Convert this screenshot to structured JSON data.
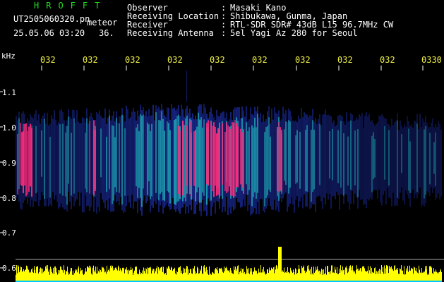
{
  "header": {
    "app_title": "HROFFT",
    "filename": "UT2505060320.pn",
    "file_type": "meteor",
    "datetime": "25.05.06 03:20",
    "value": "36."
  },
  "station_info": [
    {
      "label": "Observer",
      "value": "Masaki Kano"
    },
    {
      "label": "Receiving Location",
      "value": "Shibukawa, Gunma, Japan"
    },
    {
      "label": "Receiver",
      "value": "RTL-SDR SDR# 43dB L15 96.7MHz CW"
    },
    {
      "label": "Receiving Antenna",
      "value": "5el Yagi Az 280 for Seoul"
    }
  ],
  "separator": ":",
  "frequency_axis": {
    "unit": "kHz",
    "ticks": [
      "1.1",
      "1.0",
      "0.9",
      "0.8",
      "0.7",
      "0.6"
    ]
  },
  "time_axis": {
    "ticks": [
      "032",
      "032",
      "032",
      "032",
      "032",
      "032",
      "032",
      "032",
      "032",
      "0330"
    ]
  },
  "colors": {
    "background": "#000000",
    "title_green": "#22dd22",
    "time_tick_yellow": "#eeee44",
    "signal_low": "#1a2a9a",
    "signal_mid": "#20c8c8",
    "signal_high": "#ff2a7a",
    "level_bar": "#ffff00",
    "level_base": "#00c8ff",
    "grid_line": "#ffffff"
  }
}
